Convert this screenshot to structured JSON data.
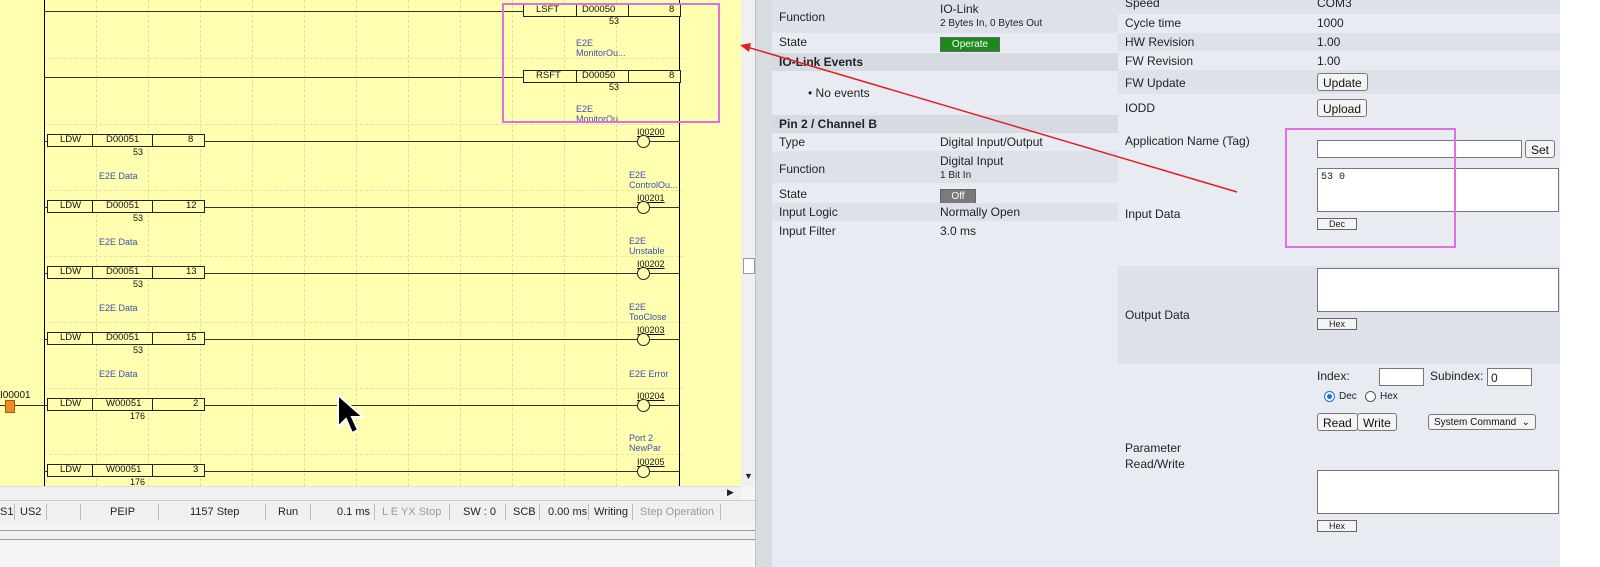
{
  "ladder": {
    "rungs": [
      {
        "instr": "LSFT",
        "operand": "D00050",
        "value": "8",
        "sub": "53",
        "comment1": "E2E",
        "comment2": "MonitorOu..."
      },
      {
        "instr": "RSFT",
        "operand": "D00050",
        "value": "8",
        "sub": "53",
        "comment1": "E2E",
        "comment2": "MonitorOu..."
      },
      {
        "instr": "LDW",
        "operand": "D00051",
        "value": "8",
        "sub": "53",
        "comment": "E2E Data",
        "coil": "I00200",
        "coil_c1": "E2E",
        "coil_c2": "ControlOu..."
      },
      {
        "instr": "LDW",
        "operand": "D00051",
        "value": "12",
        "sub": "53",
        "comment": "E2E Data",
        "coil": "I00201",
        "coil_c1": "E2E",
        "coil_c2": "Unstable"
      },
      {
        "instr": "LDW",
        "operand": "D00051",
        "value": "13",
        "sub": "53",
        "comment": "E2E Data",
        "coil": "I00202",
        "coil_c1": "E2E",
        "coil_c2": "TooClose"
      },
      {
        "instr": "LDW",
        "operand": "D00051",
        "value": "15",
        "sub": "53",
        "comment": "E2E Data",
        "coil": "I00203",
        "coil_c1": "E2E Error",
        "coil_c2": ""
      },
      {
        "instr": "LDW",
        "operand": "W00051",
        "value": "2",
        "sub": "176",
        "contact": "I00001",
        "coil": "I00204",
        "coil_c1": "Port 2",
        "coil_c2": "NewPar"
      },
      {
        "instr": "LDW",
        "operand": "W00051",
        "value": "3",
        "sub": "176",
        "coil": "I00205"
      }
    ],
    "status": {
      "s1": "S1",
      "s2": "US2",
      "mode": "PEIP",
      "steps": "1157 Step",
      "state": "Run",
      "scan": "0.1 ms",
      "flags": "L E YX Stop",
      "sw": "SW : 0",
      "scb": "SCB",
      "time": "0.00 ms",
      "writing": "Writing",
      "step_op": "Step Operation"
    }
  },
  "pin_a": {
    "function_label": "Function",
    "function_value": "IO-Link",
    "function_sub": "2 Bytes In, 0 Bytes Out",
    "state_label": "State",
    "state_value": "Operate",
    "events_header": "IO-Link Events",
    "events_item": "No events"
  },
  "pin_b": {
    "header": "Pin 2 / Channel B",
    "type_label": "Type",
    "type_value": "Digital Input/Output",
    "function_label": "Function",
    "function_value": "Digital Input",
    "function_sub": "1 Bit In",
    "state_label": "State",
    "state_value": "Off",
    "logic_label": "Input Logic",
    "logic_value": "Normally Open",
    "filter_label": "Input Filter",
    "filter_value": "3.0 ms"
  },
  "device": {
    "speed_label": "Speed",
    "speed_value": "COM3",
    "cycle_label": "Cycle time",
    "cycle_value": "1000",
    "hw_label": "HW Revision",
    "hw_value": "1.00",
    "fw_label": "FW Revision",
    "fw_value": "1.00",
    "fwupdate_label": "FW Update",
    "update_button": "Update",
    "iodd_label": "IODD",
    "upload_button": "Upload",
    "appname_label": "Application Name (Tag)",
    "set_button": "Set",
    "input_label": "Input Data",
    "input_value": "53 0",
    "input_format": "Dec",
    "output_label": "Output Data",
    "output_format": "Hex",
    "index_label": "Index:",
    "index_value": "",
    "subindex_label": "Subindex:",
    "subindex_value": "0",
    "dec_label": "Dec",
    "hex_label": "Hex",
    "read_button": "Read",
    "write_button": "Write",
    "system_command": "System Command",
    "param_label_1": "Parameter",
    "param_label_2": "Read/Write",
    "param_format": "Hex"
  },
  "colors": {
    "ladder_bg": "#ffffaf",
    "highlight": "#e070e0",
    "arrow": "#e02020",
    "operate": "#1b8a1b",
    "off": "#7a7a7a"
  }
}
